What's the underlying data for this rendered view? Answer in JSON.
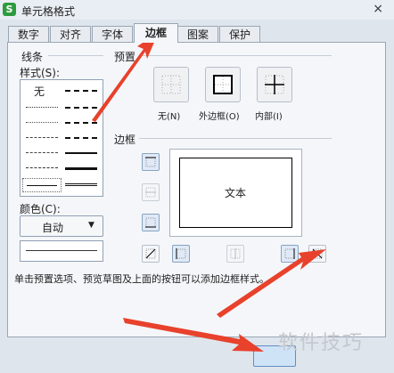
{
  "window": {
    "app_icon": "S",
    "title": "单元格格式",
    "close": "×"
  },
  "tabs": [
    {
      "label": "数字"
    },
    {
      "label": "对齐"
    },
    {
      "label": "字体"
    },
    {
      "label": "边框"
    },
    {
      "label": "图案"
    },
    {
      "label": "保护"
    }
  ],
  "line": {
    "group_label": "线条",
    "style_label": "样式(S):",
    "none_label": "无",
    "color_label": "颜色(C):",
    "color_value": "自动",
    "dropdown_arrow": "▼"
  },
  "presets": {
    "group_label": "预置",
    "items": [
      {
        "label": "无(N)",
        "icon": "border-none-icon"
      },
      {
        "label": "外边框(O)",
        "icon": "border-outline-icon"
      },
      {
        "label": "内部(I)",
        "icon": "border-inside-icon"
      }
    ]
  },
  "border": {
    "group_label": "边框",
    "preview_text": "文本"
  },
  "hint": "单击预置选项、预览草图及上面的按钮可以添加边框样式。",
  "watermark": "软件技巧",
  "colors": {
    "accent": "#5f8fc2",
    "arrow": "#e8412c"
  }
}
